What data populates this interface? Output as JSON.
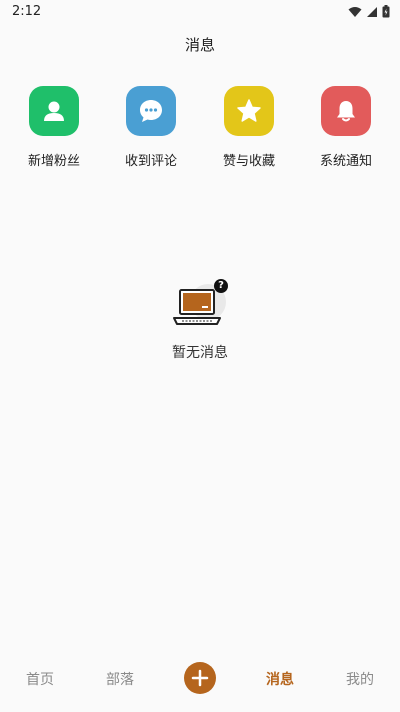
{
  "status_bar": {
    "time": "2:12"
  },
  "header": {
    "title": "消息"
  },
  "quick_actions": [
    {
      "label": "新增粉丝",
      "icon": "person-icon",
      "color": "#1fbf6a"
    },
    {
      "label": "收到评论",
      "icon": "comment-icon",
      "color": "#4a9fd3"
    },
    {
      "label": "赞与收藏",
      "icon": "star-icon",
      "color": "#e3c619"
    },
    {
      "label": "系统通知",
      "icon": "bell-icon",
      "color": "#e25b5b"
    }
  ],
  "empty_state": {
    "text": "暂无消息",
    "icon": "laptop-icon",
    "badge": "?"
  },
  "tab_bar": {
    "tabs": [
      {
        "label": "首页"
      },
      {
        "label": "部落"
      },
      {
        "label": "消息",
        "active": true
      },
      {
        "label": "我的"
      }
    ],
    "accent": "#b5651d"
  }
}
